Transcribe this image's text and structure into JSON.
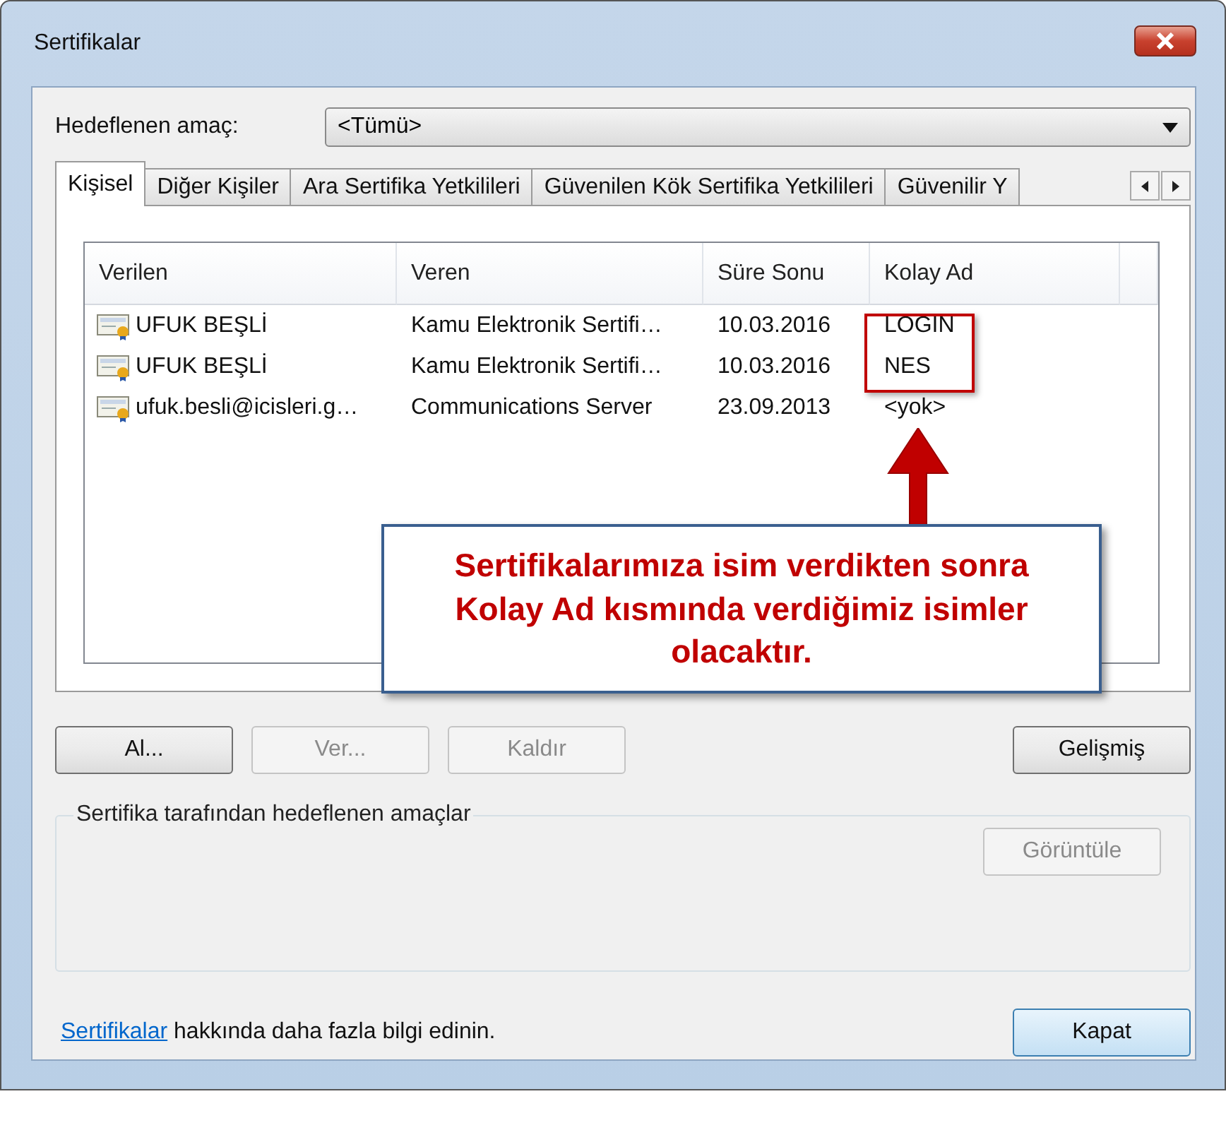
{
  "window": {
    "title": "Sertifikalar"
  },
  "purpose": {
    "label": "Hedeflenen amaç:",
    "value": "<Tümü>"
  },
  "tabs": [
    {
      "label": "Kişisel",
      "selected": true
    },
    {
      "label": "Diğer Kişiler",
      "selected": false
    },
    {
      "label": "Ara Sertifika Yetkilileri",
      "selected": false
    },
    {
      "label": "Güvenilen Kök Sertifika Yetkilileri",
      "selected": false
    },
    {
      "label": "Güvenilir Y",
      "selected": false
    }
  ],
  "table": {
    "columns": [
      "Verilen",
      "Veren",
      "Süre Sonu",
      "Kolay Ad"
    ],
    "rows": [
      [
        "UFUK BEŞLİ",
        "Kamu Elektronik Sertifi…",
        "10.03.2016",
        "LOGIN"
      ],
      [
        "UFUK BEŞLİ",
        "Kamu Elektronik Sertifi…",
        "10.03.2016",
        "NES"
      ],
      [
        "ufuk.besli@icisleri.g…",
        "Communications Server",
        "23.09.2013",
        "<yok>"
      ]
    ]
  },
  "buttons": [
    {
      "label": "Al...",
      "disabled": false
    },
    {
      "label": "Ver...",
      "disabled": true
    },
    {
      "label": "Kaldır",
      "disabled": true
    }
  ],
  "advanced_button": {
    "label": "Gelişmiş",
    "disabled": false
  },
  "purposes_group": {
    "title": "Sertifika tarafından hedeflenen amaçlar",
    "view_button": {
      "label": "Görüntüle",
      "disabled": true
    }
  },
  "footer": {
    "link": "Sertifikalar",
    "text": " hakkında daha fazla bilgi edinin."
  },
  "close_button": {
    "label": "Kapat",
    "disabled": false
  },
  "annotation": {
    "text": "Sertifikalarımıza isim verdikten sonra Kolay Ad kısmında verdiğimiz isimler olacaktır."
  }
}
